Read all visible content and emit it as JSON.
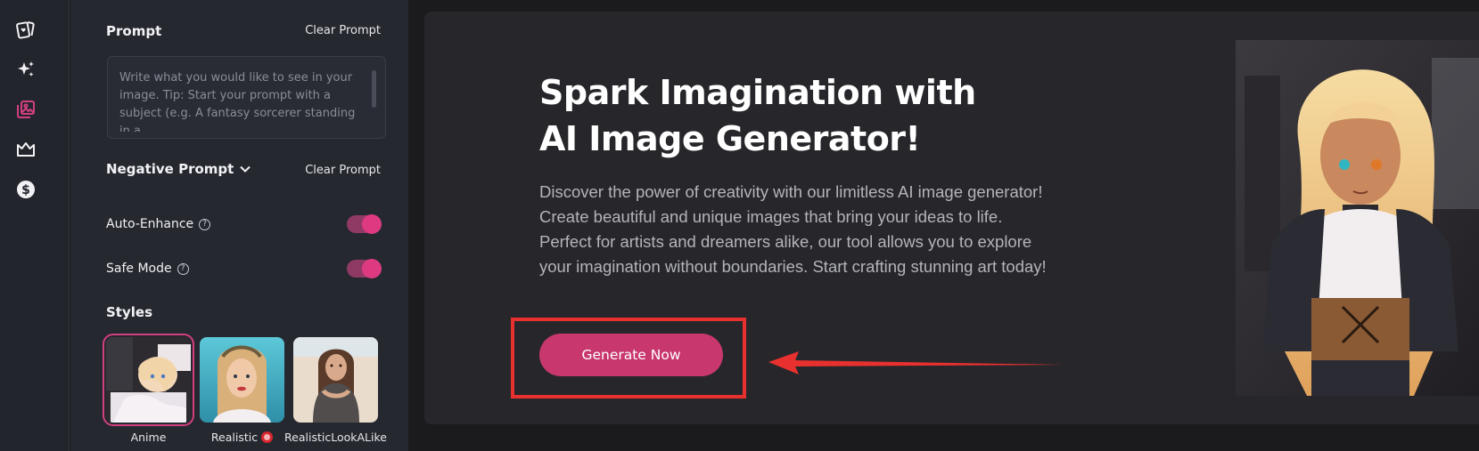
{
  "rail": {
    "icons": [
      "cards-heart-icon",
      "sparkle-icon",
      "gallery-icon",
      "crown-icon",
      "dollar-icon"
    ]
  },
  "prompt": {
    "title": "Prompt",
    "clear_label": "Clear Prompt",
    "placeholder": "Write what you would like to see in your image. Tip: Start your prompt with a subject (e.g. A fantasy sorcerer standing in a",
    "value": ""
  },
  "negative_prompt": {
    "title": "Negative Prompt",
    "clear_label": "Clear Prompt"
  },
  "toggles": {
    "auto_enhance": {
      "label": "Auto-Enhance",
      "on": true
    },
    "safe_mode": {
      "label": "Safe Mode",
      "on": true
    }
  },
  "styles": {
    "title": "Styles",
    "items": [
      {
        "label": "Anime",
        "selected": true
      },
      {
        "label": "Realistic",
        "selected": false,
        "badge": "nsfw-icon"
      },
      {
        "label": "RealisticLookALike",
        "selected": false
      }
    ]
  },
  "hero": {
    "title": "Spark Imagination with AI Image Generator!",
    "description": "Discover the power of creativity with our limitless AI image generator! Create beautiful and unique images that bring your ideas to life. Perfect for artists and dreamers alike, our tool allows you to explore your imagination without boundaries. Start crafting stunning art today!",
    "cta_label": "Generate Now"
  },
  "colors": {
    "accent": "#c8386f",
    "toggle_knob": "#de3a82",
    "annotation_red": "#e8302f",
    "panel_bg": "#262830",
    "hero_bg": "#27272b"
  }
}
